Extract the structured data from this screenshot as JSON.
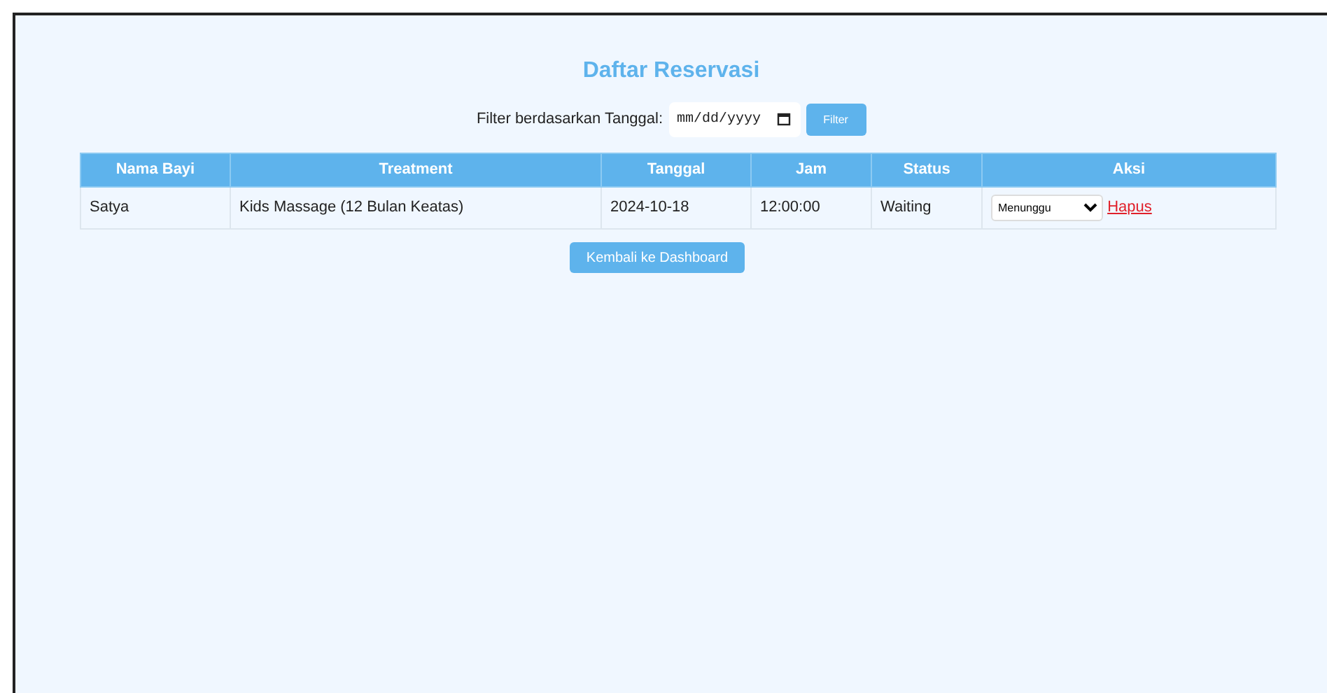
{
  "title": "Daftar Reservasi",
  "filter": {
    "label": "Filter berdasarkan Tanggal:",
    "placeholder": "mm/dd/yyyy",
    "button": "Filter"
  },
  "table": {
    "columns": [
      "Nama Bayi",
      "Treatment",
      "Tanggal",
      "Jam",
      "Status",
      "Aksi"
    ],
    "rows": [
      {
        "nama_bayi": "Satya",
        "treatment": "Kids Massage (12 Bulan Keatas)",
        "tanggal": "2024-10-18",
        "jam": "12:00:00",
        "status": "Waiting",
        "status_select": "Menunggu",
        "delete_link": "Hapus"
      }
    ]
  },
  "back_button": "Kembali ke Dashboard"
}
